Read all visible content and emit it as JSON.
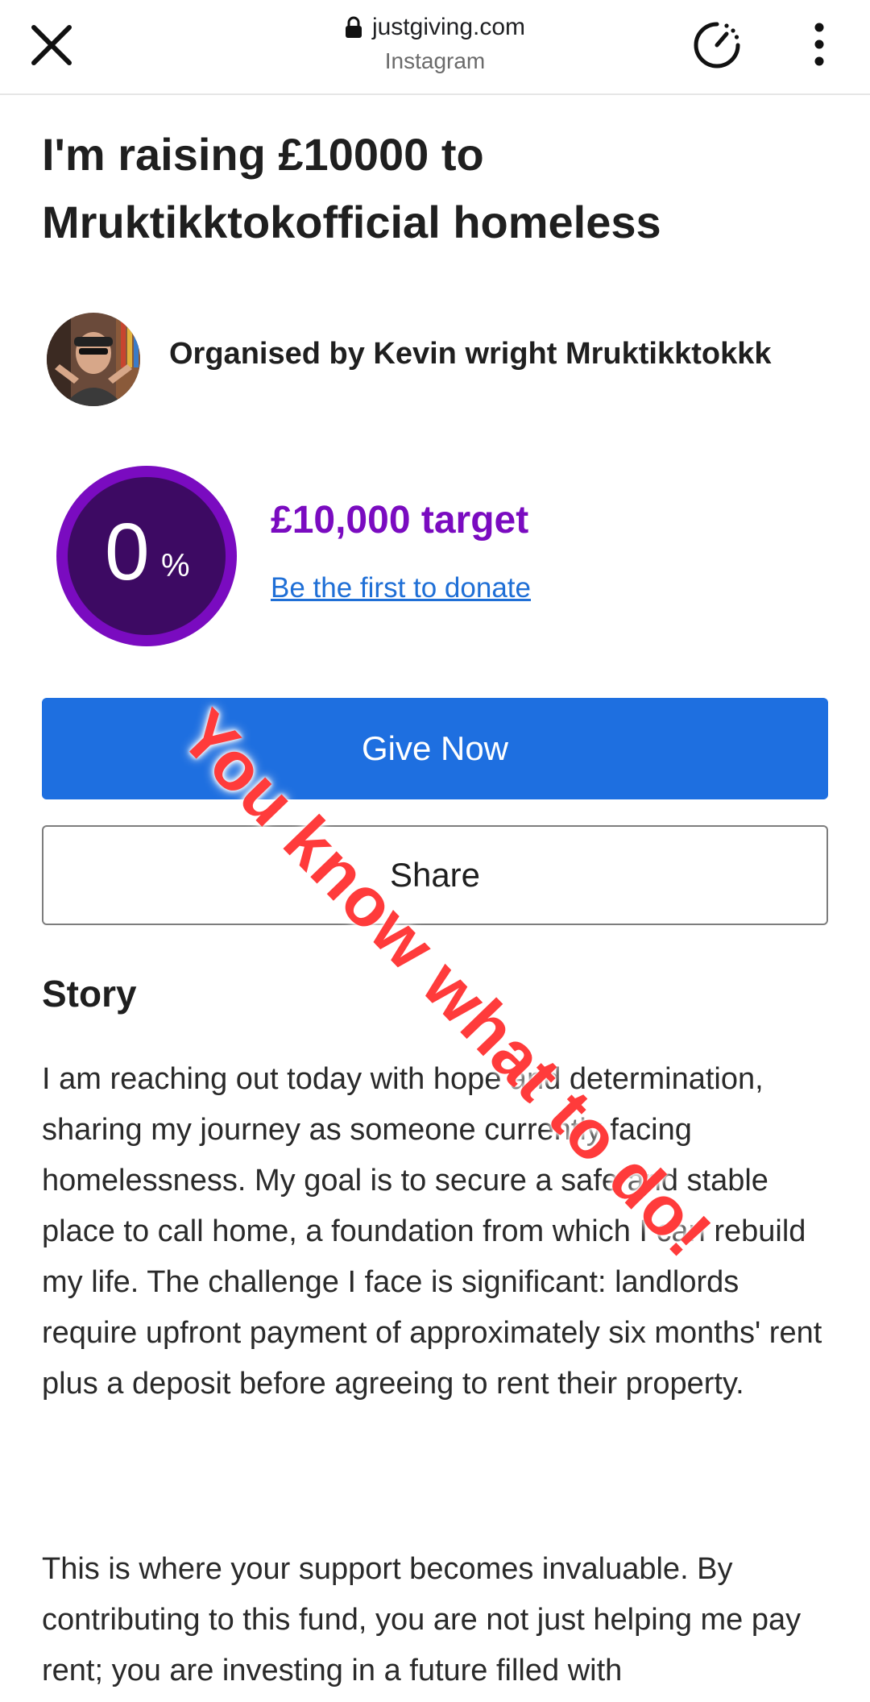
{
  "browser": {
    "domain": "justgiving.com",
    "referrer": "Instagram",
    "icons": {
      "close": "close-icon",
      "lock": "lock-icon",
      "speed": "speedometer-icon",
      "more": "more-vertical-icon"
    }
  },
  "page": {
    "title": "I'm raising £10000 to Mruktikktokofficial homeless",
    "organiser": "Organised by Kevin wright Mruktikktokkk"
  },
  "progress": {
    "percent": "0",
    "percent_sign": "%",
    "percent_value": 0,
    "target": "£10,000 target",
    "cta_link": "Be the first to donate"
  },
  "actions": {
    "give_label": "Give Now",
    "share_label": "Share"
  },
  "story": {
    "heading": "Story",
    "paragraphs": [
      "I am reaching out today with hope and determination, sharing my journey as someone currently facing homelessness. My goal is to secure a safe and stable place to call home, a foundation from which I can rebuild my life. The challenge I face is significant: landlords require upfront payment of approximately six months' rent plus a deposit before agreeing to rent their property.",
      "This is where your support becomes invaluable. By contributing to this fund, you are not just helping me pay rent; you are investing in a future filled with"
    ]
  },
  "overlay": {
    "caption": "You know what to do!"
  },
  "colors": {
    "accent_purple": "#7a0bc0",
    "ring_fill": "#3d0a63",
    "give_blue": "#1e6fe0",
    "link_blue": "#1f6fd6",
    "overlay_red": "#ff3b3b"
  }
}
